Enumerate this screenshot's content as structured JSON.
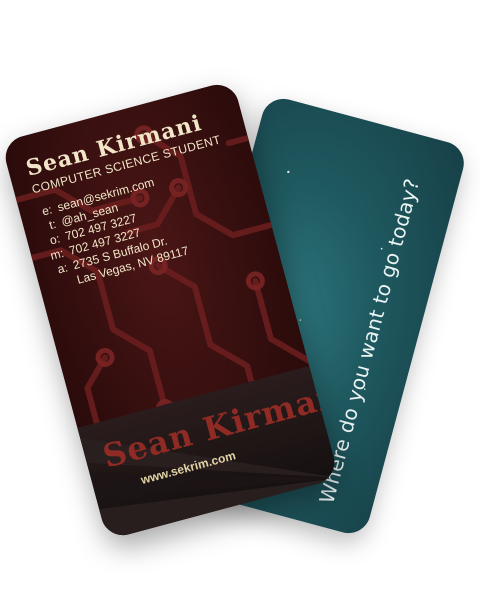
{
  "front_card": {
    "name": "Sean Kirmani",
    "title": "COMPUTER SCIENCE STUDENT",
    "contacts": [
      {
        "label": "e:",
        "value": "sean@sekrim.com"
      },
      {
        "label": "t:",
        "value": "@ah_sean"
      },
      {
        "label": "o:",
        "value": "702 497 3227"
      },
      {
        "label": "m:",
        "value": "702 497 3227"
      },
      {
        "label": "a:",
        "value": "2735 S Buffalo Dr."
      },
      {
        "label": "",
        "value": "Las Vegas, NV 89117"
      }
    ],
    "bottom_name": "Sean Kirmani",
    "website": "www.sekrim.com"
  },
  "back_card": {
    "tagline": "Where do you want to go today?"
  }
}
